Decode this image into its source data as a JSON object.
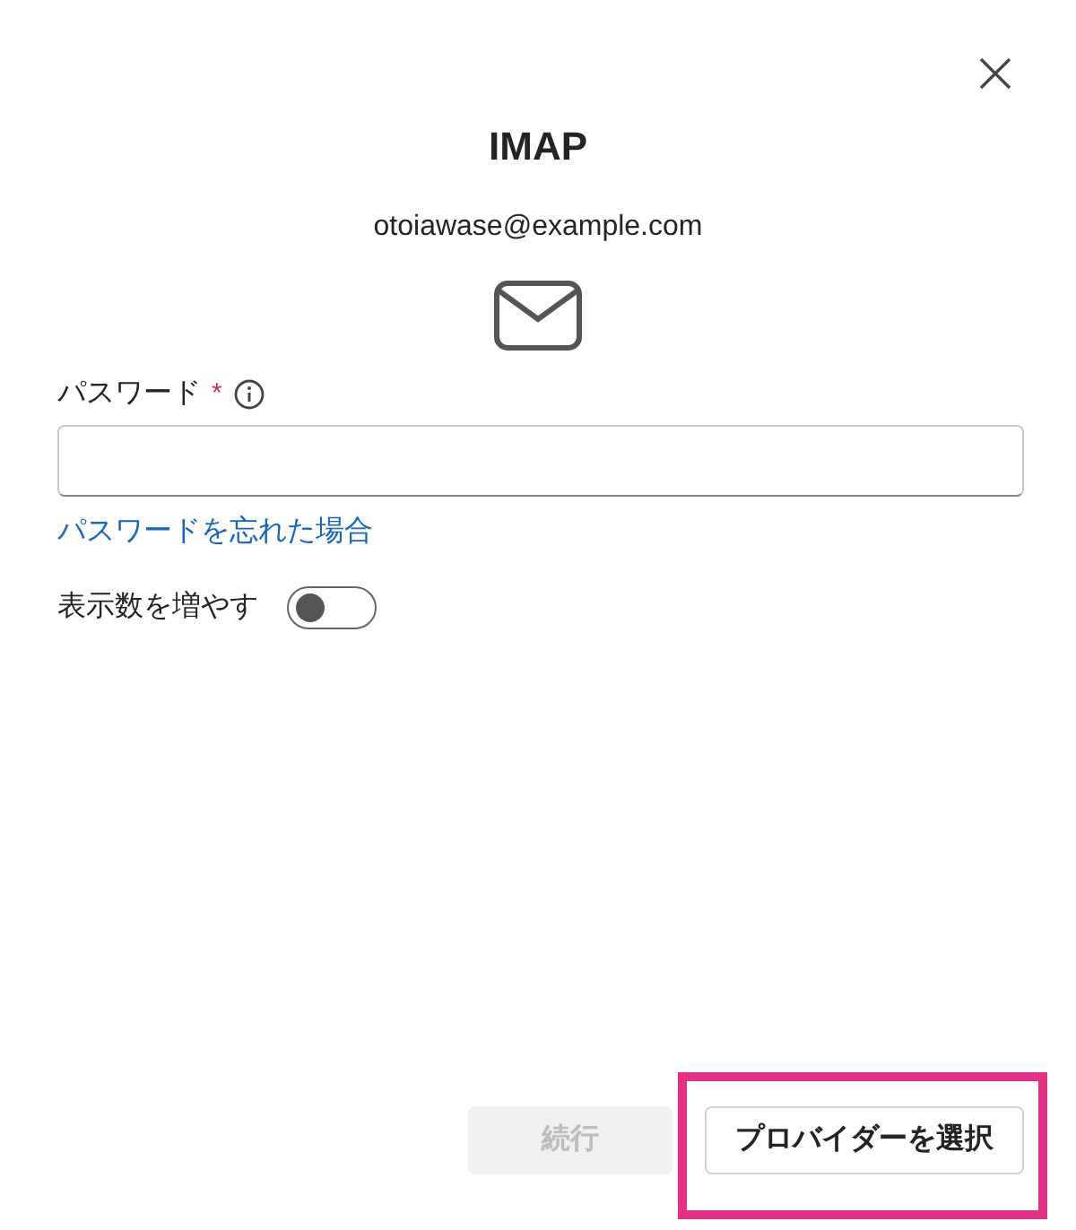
{
  "dialog": {
    "title": "IMAP",
    "email": "otoiawase@example.com"
  },
  "password": {
    "label": "パスワード",
    "required_mark": "*"
  },
  "forgot_link": "パスワードを忘れた場合",
  "toggle": {
    "label": "表示数を増やす",
    "on": false
  },
  "buttons": [
    {
      "label": "続行",
      "disabled": true,
      "highlighted": false
    },
    {
      "label": "プロバイダーを選択",
      "disabled": false,
      "highlighted": true
    }
  ]
}
